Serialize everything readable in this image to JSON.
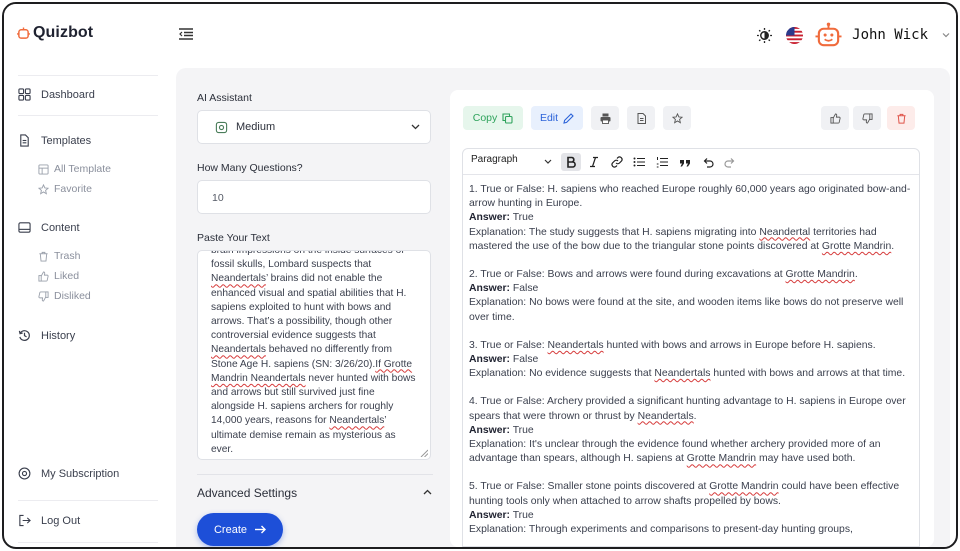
{
  "app": {
    "name": "Quizbot"
  },
  "user": {
    "name": "John Wick"
  },
  "colors": {
    "accent": "#1d4fd8",
    "brand": "#f06b3c",
    "copy": "#2fa35c",
    "edit": "#2b63d9",
    "danger": "#e0554b"
  },
  "sidebar": {
    "dashboard": "Dashboard",
    "templates": "Templates",
    "all_template": "All Template",
    "favorite": "Favorite",
    "content": "Content",
    "trash": "Trash",
    "liked": "Liked",
    "disliked": "Disliked",
    "history": "History",
    "subscription": "My Subscription",
    "logout": "Log Out"
  },
  "form": {
    "ai_label": "AI Assistant",
    "ai_value": "Medium",
    "questions_label": "How Many Questions?",
    "questions_value": "10",
    "text_label": "Paste Your Text",
    "text_segments": [
      {
        "t": "brain impressions on the inside surfaces of fossil skulls, Lombard suspects that ",
        "s": false
      },
      {
        "t": "Neandertals",
        "s": true
      },
      {
        "t": "’ brains did not enable the enhanced visual and spatial abilities that H. sapiens exploited to hunt with bows and arrows. That’s a possibility, though other controversial evidence suggests that ",
        "s": false
      },
      {
        "t": "Neandertals",
        "s": true
      },
      {
        "t": " behaved no differently from Stone Age H. sapiens (SN: 3/26/20).",
        "s": false
      },
      {
        "t": "If Grotte Mandrin Neandertals",
        "s": true
      },
      {
        "t": " never hunted with bows and arrows but still survived just fine alongside H. sapiens archers for roughly 14,000 years, reasons for ",
        "s": false
      },
      {
        "t": "Neandertals",
        "s": true
      },
      {
        "t": "’ ultimate demise remain as mysterious as ever.",
        "s": false
      }
    ],
    "advanced": "Advanced Settings",
    "create": "Create"
  },
  "toolbar": {
    "copy": "Copy",
    "edit": "Edit",
    "paragraph": "Paragraph"
  },
  "content": {
    "answer_label": "Answer:",
    "questions": [
      {
        "q": [
          {
            "t": "1. True or False: H. sapiens who reached Europe roughly 60,000 years ago originated bow-and-arrow hunting in Europe.",
            "s": false
          }
        ],
        "a": "True",
        "e": [
          {
            "t": "Explanation: The study suggests that H. sapiens migrating into ",
            "s": false
          },
          {
            "t": "Neandertal",
            "s": true
          },
          {
            "t": " territories had mastered the use of the bow due to the triangular stone points discovered at ",
            "s": false
          },
          {
            "t": "Grotte Mandrin",
            "s": true
          },
          {
            "t": ".",
            "s": false
          }
        ]
      },
      {
        "q": [
          {
            "t": "2. True or False: Bows and arrows were found during excavations at ",
            "s": false
          },
          {
            "t": "Grotte Mandrin",
            "s": true
          },
          {
            "t": ".",
            "s": false
          }
        ],
        "a": "False",
        "e": [
          {
            "t": "Explanation: No bows were found at the site, and wooden items like bows do not preserve well over time.",
            "s": false
          }
        ]
      },
      {
        "q": [
          {
            "t": "3. True or False: ",
            "s": false
          },
          {
            "t": "Neandertals",
            "s": true
          },
          {
            "t": " hunted with bows and arrows in Europe before H. sapiens.",
            "s": false
          }
        ],
        "a": "False",
        "e": [
          {
            "t": "Explanation: No evidence suggests that ",
            "s": false
          },
          {
            "t": "Neandertals",
            "s": true
          },
          {
            "t": " hunted with bows and arrows at that time.",
            "s": false
          }
        ]
      },
      {
        "q": [
          {
            "t": "4. True or False: Archery provided a significant hunting advantage to H. sapiens in Europe over spears that were thrown or thrust by ",
            "s": false
          },
          {
            "t": "Neandertals",
            "s": true
          },
          {
            "t": ".",
            "s": false
          }
        ],
        "a": "True",
        "e": [
          {
            "t": "Explanation: It's unclear through the evidence found whether archery provided more of an advantage than spears, although H. sapiens at ",
            "s": false
          },
          {
            "t": "Grotte Mandrin",
            "s": true
          },
          {
            "t": " may have used both.",
            "s": false
          }
        ]
      },
      {
        "q": [
          {
            "t": "5. True or False: Smaller stone points discovered at ",
            "s": false
          },
          {
            "t": "Grotte Mandrin",
            "s": true
          },
          {
            "t": " could have been effective hunting tools only when attached to arrow shafts propelled by bows.",
            "s": false
          }
        ],
        "a": "True",
        "e": [
          {
            "t": "Explanation: Through experiments and comparisons to present-day hunting groups,",
            "s": false
          }
        ]
      }
    ]
  }
}
